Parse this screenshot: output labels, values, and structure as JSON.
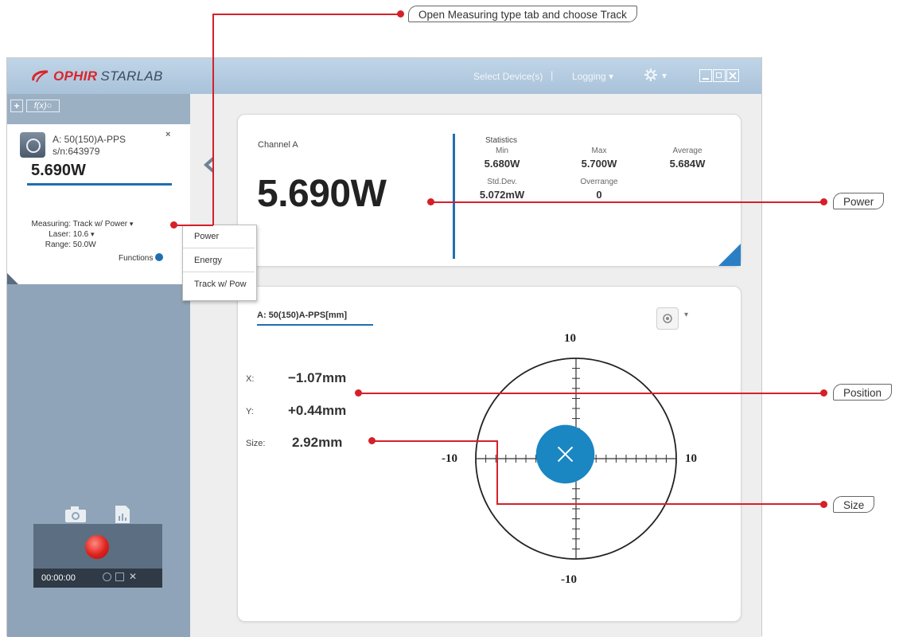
{
  "app": {
    "brand_name": "OPHIR",
    "brand_product": "STARLAB",
    "select_devices": "Select Device(s)",
    "separator": "|",
    "logging": "Logging",
    "gear_caret": "▾"
  },
  "toolbar": {
    "add": "+",
    "function": "f(x)"
  },
  "device": {
    "name": "A: 50(150)A-PPS",
    "serial": "s/n:643979",
    "reading": "5.690W",
    "close": "×",
    "measuring_label": "Measuring:",
    "measuring_value": "Track w/ Power",
    "laser_label": "Laser:",
    "laser_value": "10.6",
    "range_label": "Range:",
    "range_value": "50.0W",
    "functions": "Functions"
  },
  "measuring_menu": {
    "items": [
      "Power",
      "Energy",
      "Track w/ Pow"
    ]
  },
  "recorder": {
    "time": "00:00:00"
  },
  "channel_panel": {
    "channel": "Channel A",
    "reading": "5.690W",
    "statistics_title": "Statistics",
    "min_label": "Min",
    "min_value": "5.680W",
    "max_label": "Max",
    "max_value": "5.700W",
    "avg_label": "Average",
    "avg_value": "5.684W",
    "std_label": "Std.Dev.",
    "std_value": "5.072mW",
    "over_label": "Overrange",
    "over_value": "0"
  },
  "position_panel": {
    "title": "A: 50(150)A-PPS[mm]",
    "x_label": "X:",
    "x_value": "−1.07mm",
    "y_label": "Y:",
    "y_value": "+0.44mm",
    "size_label": "Size:",
    "size_value": "2.92mm",
    "axis_top": "10",
    "axis_bottom": "-10",
    "axis_left": "-10",
    "axis_right": "10",
    "beam_x_mm": -1.07,
    "beam_y_mm": 0.44,
    "beam_size_mm": 2.92
  },
  "callouts": {
    "measuring": "Open Measuring type tab and choose Track",
    "power": "Power",
    "position": "Position",
    "size": "Size"
  },
  "colors": {
    "accent": "#1f6fb0",
    "callout_line": "#d5202a",
    "beam": "#1a86c2"
  }
}
